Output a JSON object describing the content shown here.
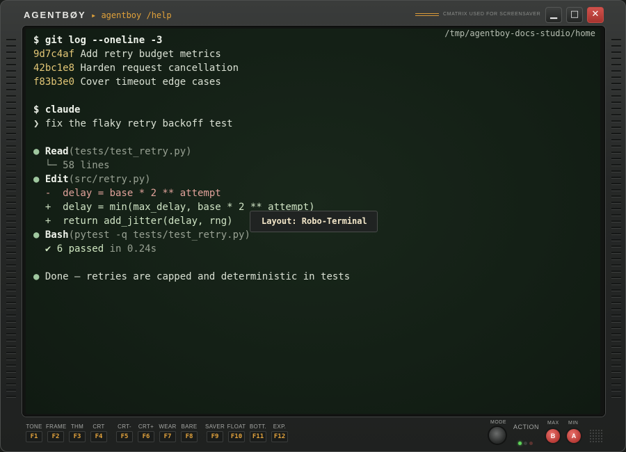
{
  "titlebar": {
    "brand": "AGENTBØY",
    "path": "▸ agentboy /help",
    "saver_label": "CMATRIX USED FOR SCREENSAVER",
    "minimize_glyph": "▁",
    "maximize_glyph": "□",
    "close_glyph": "✕"
  },
  "screen": {
    "cwd": "/tmp/agentboy-docs-studio/home",
    "tooltip": "Layout: Robo-Terminal",
    "lines": [
      {
        "kind": "cmd",
        "prompt": "$",
        "text": "git log --oneline -3"
      },
      {
        "kind": "commit",
        "hash": "9d7c4af",
        "text": "Add retry budget metrics"
      },
      {
        "kind": "commit",
        "hash": "42bc1e8",
        "text": "Harden request cancellation"
      },
      {
        "kind": "commit",
        "hash": "f83b3e0",
        "text": "Cover timeout edge cases"
      },
      {
        "kind": "blank"
      },
      {
        "kind": "cmd",
        "prompt": "$",
        "text": "claude"
      },
      {
        "kind": "input",
        "prompt": "❯",
        "text": "fix the flaky retry backoff test"
      },
      {
        "kind": "blank"
      },
      {
        "kind": "tool",
        "bullet": "●",
        "tool": "Read",
        "arg": "(tests/test_retry.py)"
      },
      {
        "kind": "result",
        "text": "  └─ 58 lines"
      },
      {
        "kind": "tool",
        "bullet": "●",
        "tool": "Edit",
        "arg": "(src/retry.py)"
      },
      {
        "kind": "minus",
        "text": "  -  delay = base * 2 ** attempt"
      },
      {
        "kind": "plus",
        "text": "  +  delay = min(max_delay, base * 2 ** attempt)"
      },
      {
        "kind": "plus",
        "text": "  +  return add_jitter(delay, rng)"
      },
      {
        "kind": "tool",
        "bullet": "●",
        "tool": "Bash",
        "arg": "(pytest -q tests/test_retry.py)"
      },
      {
        "kind": "passed",
        "mark": "  ✔",
        "count": "6 passed",
        "rest": " in 0.24s"
      },
      {
        "kind": "blank"
      },
      {
        "kind": "done",
        "bullet": "●",
        "text": "Done — retries are capped and deterministic in tests"
      }
    ]
  },
  "fkeys": [
    {
      "label": "TONE",
      "key": "F1"
    },
    {
      "label": "FRAME",
      "key": "F2"
    },
    {
      "label": "THM",
      "key": "F3"
    },
    {
      "label": "CRT",
      "key": "F4"
    },
    {
      "label": "CRT-",
      "key": "F5"
    },
    {
      "label": "CRT+",
      "key": "F6"
    },
    {
      "label": "WEAR",
      "key": "F7"
    },
    {
      "label": "BARE",
      "key": "F8"
    },
    {
      "label": "SAVER",
      "key": "F9"
    },
    {
      "label": "FLOAT",
      "key": "F10"
    },
    {
      "label": "BOTT.",
      "key": "F11"
    },
    {
      "label": "EXP.",
      "key": "F12"
    }
  ],
  "controls": {
    "mode_label": "MODE",
    "action_label": "ACTION",
    "max_label": "MAX",
    "min_label": "MIN",
    "b_label": "B",
    "a_label": "A"
  },
  "colors": {
    "accent": "#e0a13a",
    "close": "#c2453f",
    "led_on": "#5fd45a"
  }
}
